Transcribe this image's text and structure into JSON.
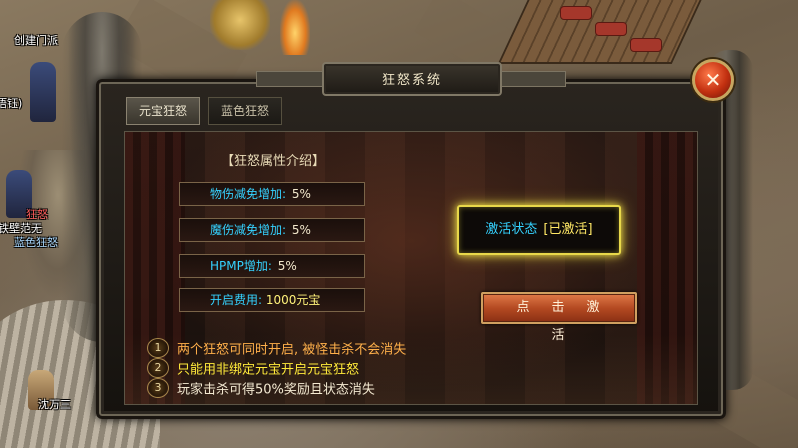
{
  "window": {
    "title": "狂怒系统",
    "close_symbol": "✕"
  },
  "tabs": [
    {
      "label": "元宝狂怒",
      "active": true
    },
    {
      "label": "蓝色狂怒",
      "active": false
    }
  ],
  "content": {
    "section_title": "【狂怒属性介绍】",
    "attributes": [
      {
        "name": "物伤减免增加:",
        "value": "5%"
      },
      {
        "name": "魔伤减免增加:",
        "value": "5%"
      },
      {
        "name": "HPMP增加:",
        "value": "5%"
      }
    ],
    "cost": {
      "name": "开启费用:",
      "value": "1000元宝"
    },
    "status": {
      "label": "激活状态",
      "value": "[已激活]"
    },
    "activate_button": "点击激活",
    "rules": [
      {
        "num": "1",
        "text": "两个狂怒可同时开启, 被怪击杀不会消失"
      },
      {
        "num": "2",
        "text": "只能用非绑定元宝开启元宝狂怒"
      },
      {
        "num": "3",
        "text": "玩家击杀可得50%奖励且状态消失"
      }
    ]
  },
  "world": {
    "guild_button": "创建门派",
    "npc_name_1": "悟钰)",
    "npc_name_2": "铁壁范无",
    "npc_title_red": "狂怒",
    "npc_title_blue": "蓝色狂怒",
    "npc_name_3": "沈万三"
  },
  "colors": {
    "cyan_text": "#35d2ff",
    "gold_text": "#ffe866",
    "orange_rule": "#ffb04a",
    "yellow_rule": "#ffea3a",
    "button_orange": "#c04e24",
    "close_red": "#c23010"
  }
}
